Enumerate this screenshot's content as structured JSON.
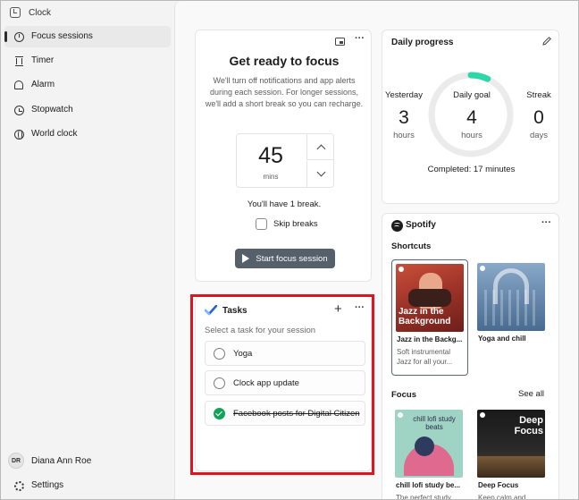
{
  "app": {
    "title": "Clock"
  },
  "sidebar": {
    "items": [
      {
        "label": "Focus sessions",
        "icon": "focus-icon",
        "active": true
      },
      {
        "label": "Timer",
        "icon": "hourglass-icon"
      },
      {
        "label": "Alarm",
        "icon": "bell-icon"
      },
      {
        "label": "Stopwatch",
        "icon": "stopwatch-icon"
      },
      {
        "label": "World clock",
        "icon": "globe-icon"
      }
    ],
    "user": {
      "initials": "DR",
      "name": "Diana Ann Roe"
    },
    "settings_label": "Settings"
  },
  "focus": {
    "title": "Get ready to focus",
    "description": "We'll turn off notifications and app alerts during each session. For longer sessions, we'll add a short break so you can recharge.",
    "duration_value": "45",
    "duration_unit": "mins",
    "break_text": "You'll have 1 break.",
    "skip_label": "Skip breaks",
    "start_label": "Start focus session"
  },
  "tasks": {
    "title": "Tasks",
    "hint": "Select a task for your session",
    "items": [
      {
        "label": "Yoga",
        "done": false
      },
      {
        "label": "Clock app update",
        "done": false
      },
      {
        "label": "Facebook posts for Digital Citizen",
        "done": true
      }
    ]
  },
  "progress": {
    "title": "Daily progress",
    "yesterday": {
      "label": "Yesterday",
      "value": "3",
      "unit": "hours"
    },
    "goal": {
      "label": "Daily goal",
      "value": "4",
      "unit": "hours",
      "fraction_complete": 0.07
    },
    "streak": {
      "label": "Streak",
      "value": "0",
      "unit": "days"
    },
    "completed": "Completed: 17 minutes",
    "accent": "#2fd6a8"
  },
  "spotify": {
    "name": "Spotify",
    "shortcuts_label": "Shortcuts",
    "focus_label": "Focus",
    "see_all": "See all",
    "shortcuts": [
      {
        "art_text": "Jazz in the Background",
        "title": "Jazz in the Backg...",
        "desc": "Soft instrumental Jazz for all your..."
      },
      {
        "title": "Yoga and chill",
        "desc": ""
      }
    ],
    "focus": [
      {
        "art_text": "chill lofi study beats",
        "title": "chill lofi study be...",
        "desc": "The perfect study..."
      },
      {
        "art_text": "Deep Focus",
        "title": "Deep Focus",
        "desc": "Keep calm and..."
      }
    ]
  }
}
